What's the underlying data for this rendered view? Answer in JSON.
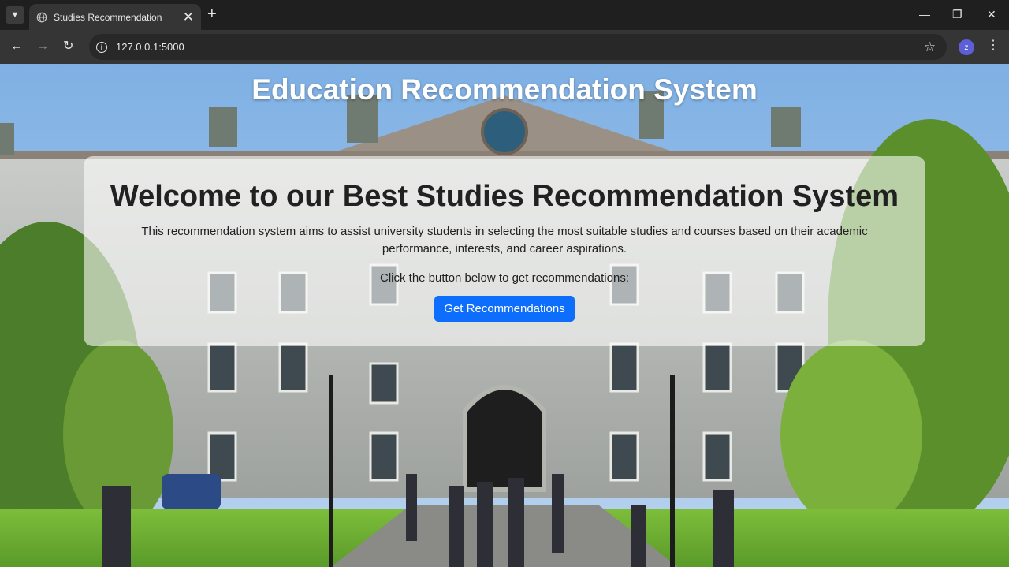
{
  "browser": {
    "tab_title": "Studies Recommendation",
    "tab_close": "✕",
    "new_tab": "+",
    "url": "127.0.0.1:5000",
    "profile_initial": "z",
    "icons": {
      "tab_list": "chevron-down-icon",
      "favicon": "globe-icon",
      "back": "back-arrow-icon",
      "forward": "forward-arrow-icon",
      "reload": "reload-icon",
      "site_info": "info-icon",
      "bookmark": "star-icon",
      "menu": "kebab-menu-icon"
    },
    "window_controls": {
      "minimize": "—",
      "restore": "❐",
      "close": "✕"
    }
  },
  "page": {
    "title": "Education Recommendation System",
    "welcome_heading": "Welcome to our Best Studies Recommendation System",
    "description": "This recommendation system aims to assist university students in selecting the most suitable studies and courses based on their academic performance, interests, and career aspirations.",
    "prompt": "Click the button below to get recommendations:",
    "button_label": "Get Recommendations",
    "button_color": "#0d6efd",
    "background": "photo of a university building with students and trees"
  }
}
